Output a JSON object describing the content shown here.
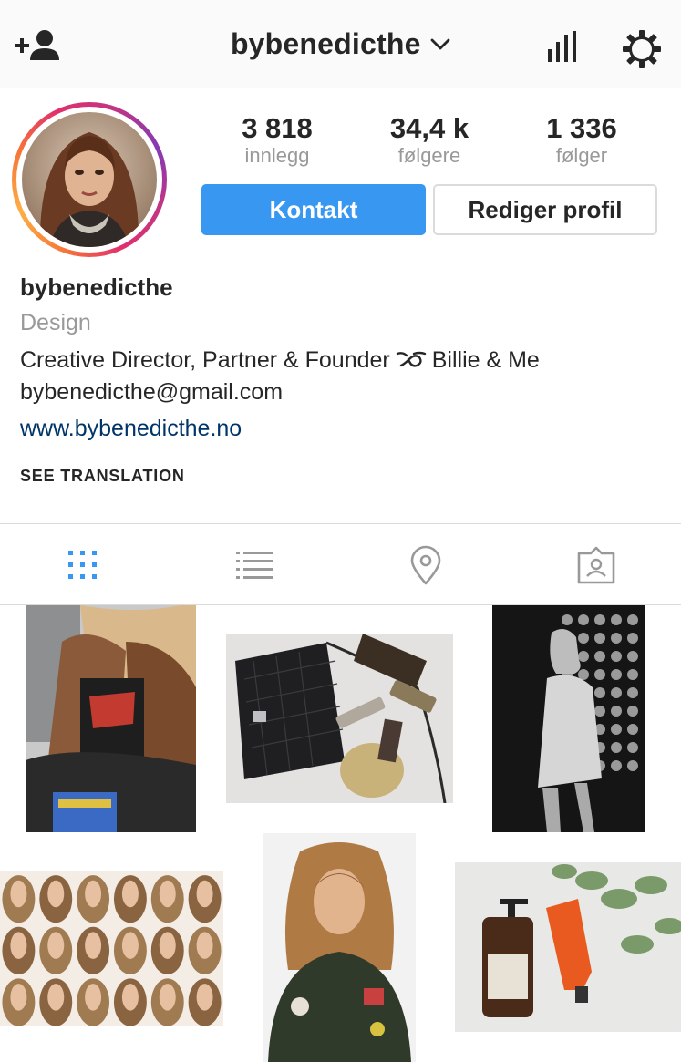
{
  "topbar": {
    "username": "bybenedicthe",
    "icons": {
      "left": "add-user-icon",
      "dropdown": "chevron-down-icon",
      "insights": "insights-icon",
      "settings": "gear-icon"
    }
  },
  "profile": {
    "stats": [
      {
        "value": "3 818",
        "label": "innlegg"
      },
      {
        "value": "34,4 k",
        "label": "følgere"
      },
      {
        "value": "1 336",
        "label": "følger"
      }
    ],
    "contact_label": "Kontakt",
    "edit_label": "Rediger profil",
    "accent_color": "#3897f0",
    "story_ring_colors": [
      "#833ab4",
      "#c13584",
      "#e1306c",
      "#f77737",
      "#fcaf45"
    ]
  },
  "bio": {
    "name": "bybenedicthe",
    "category": "Design",
    "line1_before": "Creative Director, Partner & Founder",
    "line1_after": "Billie & Me",
    "line2": "bybenedicthe@gmail.com",
    "website": "www.bybenedicthe.no",
    "see_translation": "SEE TRANSLATION"
  },
  "tabs": [
    {
      "name": "grid-view-icon",
      "active": true
    },
    {
      "name": "list-view-icon",
      "active": false
    },
    {
      "name": "location-pin-icon",
      "active": false
    },
    {
      "name": "tagged-photos-icon",
      "active": false
    }
  ]
}
